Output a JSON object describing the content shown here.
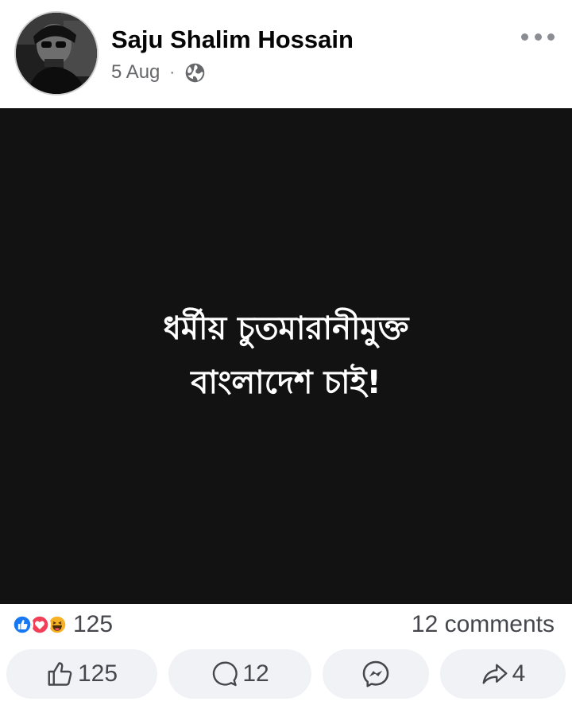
{
  "post": {
    "author": "Saju Shalim Hossain",
    "date": "5 Aug",
    "separator": "·",
    "privacy_icon": "globe-icon",
    "text_line1": "ধর্মীয় চুতমারানীমুক্ত",
    "text_line2": "বাংলাদেশ চাই!"
  },
  "stats": {
    "reaction_icons": [
      "like-reaction-icon",
      "love-reaction-icon",
      "haha-reaction-icon"
    ],
    "reaction_count": "125",
    "comments_label": "12 comments"
  },
  "actions": {
    "like_count": "125",
    "comment_count": "12",
    "share_count": "4"
  },
  "colors": {
    "like_blue": "#1877f2",
    "love_red": "#f33e58",
    "haha_yellow": "#f7b125",
    "image_bg": "#121212",
    "button_bg": "#f0f2f5"
  }
}
